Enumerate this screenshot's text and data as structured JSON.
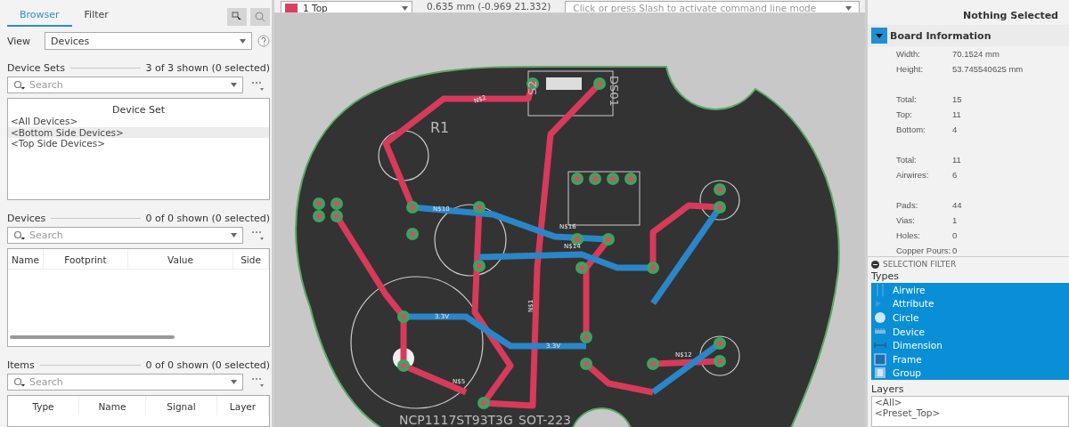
{
  "left_panel": {
    "tabs": [
      {
        "label": "Browser",
        "selected": true
      },
      {
        "label": "Filter",
        "selected": false
      }
    ],
    "view": {
      "label": "View",
      "value": "Devices"
    },
    "device_sets": {
      "title": "Device Sets",
      "count": "3 of 3 shown (0 selected)",
      "search": {
        "placeholder": "Search"
      },
      "column": "Device Set",
      "rows": [
        {
          "text": "<All Devices>",
          "selected": false
        },
        {
          "text": "<Bottom Side Devices>",
          "selected": true
        },
        {
          "text": "<Top Side Devices>",
          "selected": false
        }
      ]
    },
    "devices": {
      "title": "Devices",
      "count": "0 of 0 shown (0 selected)",
      "search": {
        "placeholder": "Search"
      },
      "columns": [
        "Name",
        "Footprint",
        "Value",
        "Side"
      ]
    },
    "items": {
      "title": "Items",
      "count": "0 of 0 shown (0 selected)",
      "search": {
        "placeholder": "Search"
      },
      "columns": [
        "Type",
        "Name",
        "Signal",
        "Layer"
      ]
    }
  },
  "toolbar": {
    "layer": {
      "label": "1 Top",
      "color": "#d8405e"
    },
    "coordinates": "0.635 mm (-0.969 21.332)",
    "command": {
      "placeholder": "Click or press Slash to activate command line mode"
    }
  },
  "pcb_labels": [
    "R1",
    "N$2",
    "N$10",
    "N$16",
    "N$14",
    "N$1",
    "N$5",
    "N$12",
    "3.3V",
    "3.3V",
    "NCP1117ST93T3G",
    "SOT-223",
    "DS01",
    "S2"
  ],
  "inspector": {
    "status": "Nothing Selected",
    "section": {
      "title": "Board Information",
      "expanded": true,
      "groups": [
        [
          {
            "label": "Width:",
            "value": "70.1524 mm"
          },
          {
            "label": "Height:",
            "value": "53.745540625 mm"
          }
        ],
        [
          {
            "label": "Total:",
            "value": "15"
          },
          {
            "label": "Top:",
            "value": "11"
          },
          {
            "label": "Bottom:",
            "value": "4"
          }
        ],
        [
          {
            "label": "Total:",
            "value": "11"
          },
          {
            "label": "Airwires:",
            "value": "6"
          }
        ],
        [
          {
            "label": "Pads:",
            "value": "44"
          },
          {
            "label": "Vias:",
            "value": "1"
          },
          {
            "label": "Holes:",
            "value": "0"
          },
          {
            "label": "Copper Pours:",
            "value": "0"
          }
        ]
      ]
    }
  },
  "selection_filter": {
    "title": "SELECTION FILTER",
    "types_label": "Types",
    "types": [
      {
        "kind": "airwire",
        "label": "Airwire",
        "selected": true
      },
      {
        "kind": "attribute",
        "label": "Attribute",
        "selected": true
      },
      {
        "kind": "circle",
        "label": "Circle",
        "selected": true
      },
      {
        "kind": "device",
        "label": "Device",
        "selected": true
      },
      {
        "kind": "dimension",
        "label": "Dimension",
        "selected": true
      },
      {
        "kind": "frame",
        "label": "Frame",
        "selected": true
      },
      {
        "kind": "group",
        "label": "Group",
        "selected": true
      }
    ],
    "layers_label": "Layers",
    "layers": [
      {
        "text": "<All>",
        "selected": false
      },
      {
        "text": "<Preset_Top>",
        "selected": false
      }
    ]
  }
}
